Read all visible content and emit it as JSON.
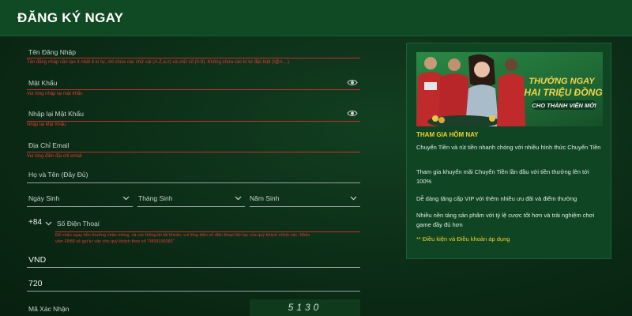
{
  "header": {
    "title": "ĐĂNG KÝ NGAY"
  },
  "form": {
    "username": {
      "label": "Tên Đăng Nhập",
      "error": "Tên đăng nhập cần tạo ít nhất 6 kí tự, chỉ chứa các chữ cái (A-Z,a-z) và chữ số (0-9). Không chứa các kí tự đặc biệt (!@#,...)"
    },
    "password": {
      "label": "Mật Khẩu",
      "error": "Vui lòng nhập lại mật khẩu"
    },
    "confirm_password": {
      "label": "Nhập lại Mật Khẩu",
      "error": "Nhập lại Mật Khẩu"
    },
    "email": {
      "label": "Địa Chỉ Email",
      "error": "Vui lòng điền địa chỉ email"
    },
    "fullname": {
      "label": "Họ và Tên (Đầy Đủ)"
    },
    "dob": {
      "day": "Ngày Sinh",
      "month": "Tháng Sinh",
      "year": "Năm Sinh"
    },
    "phone": {
      "country_code": "+84",
      "label": "Số Điện Thoại",
      "error_line1": "Để nhận ngay tiền thưởng chào mừng, và các thông tin tài khoản, vui lòng điền số điện thoại liên lạc của quý khách chính xác. Nhân",
      "error_line2": "viên FB88 sẽ gọi tư vấn cho quý khách theo số \"0899199383\"."
    },
    "currency": {
      "value": "VND"
    },
    "amount": {
      "value": "720"
    },
    "captcha": {
      "label": "Mã Xác Nhận",
      "code": "5130"
    }
  },
  "promo": {
    "banner_text1": "THƯỞNG NGAY",
    "banner_text2": "HAI TRIỆU ĐỒNG",
    "banner_text3": "CHO THÀNH VIÊN MỚI",
    "title": "THAM GIA HÔM NAY",
    "items": [
      "Chuyển Tiền và rút tiền nhanh chóng với nhiều hình thức Chuyển Tiền",
      "Tham gia khuyến mãi Chuyển Tiền lần đầu với tiền thưởng lên tới 100%",
      "Dễ dàng tăng cấp VIP với thêm nhiều ưu đãi và điểm thưởng",
      "Nhiều nền tảng sản phẩm với tỷ lệ cược tốt hơn và trải nghiệm chơi game đầy đủ hơn"
    ],
    "note": "** Điều kiện và Điều khoản áp dụng"
  },
  "colors": {
    "background": "#0b2c16",
    "header": "#0f4a24",
    "error": "#e03a3a",
    "accent_yellow": "#f2d12e"
  }
}
